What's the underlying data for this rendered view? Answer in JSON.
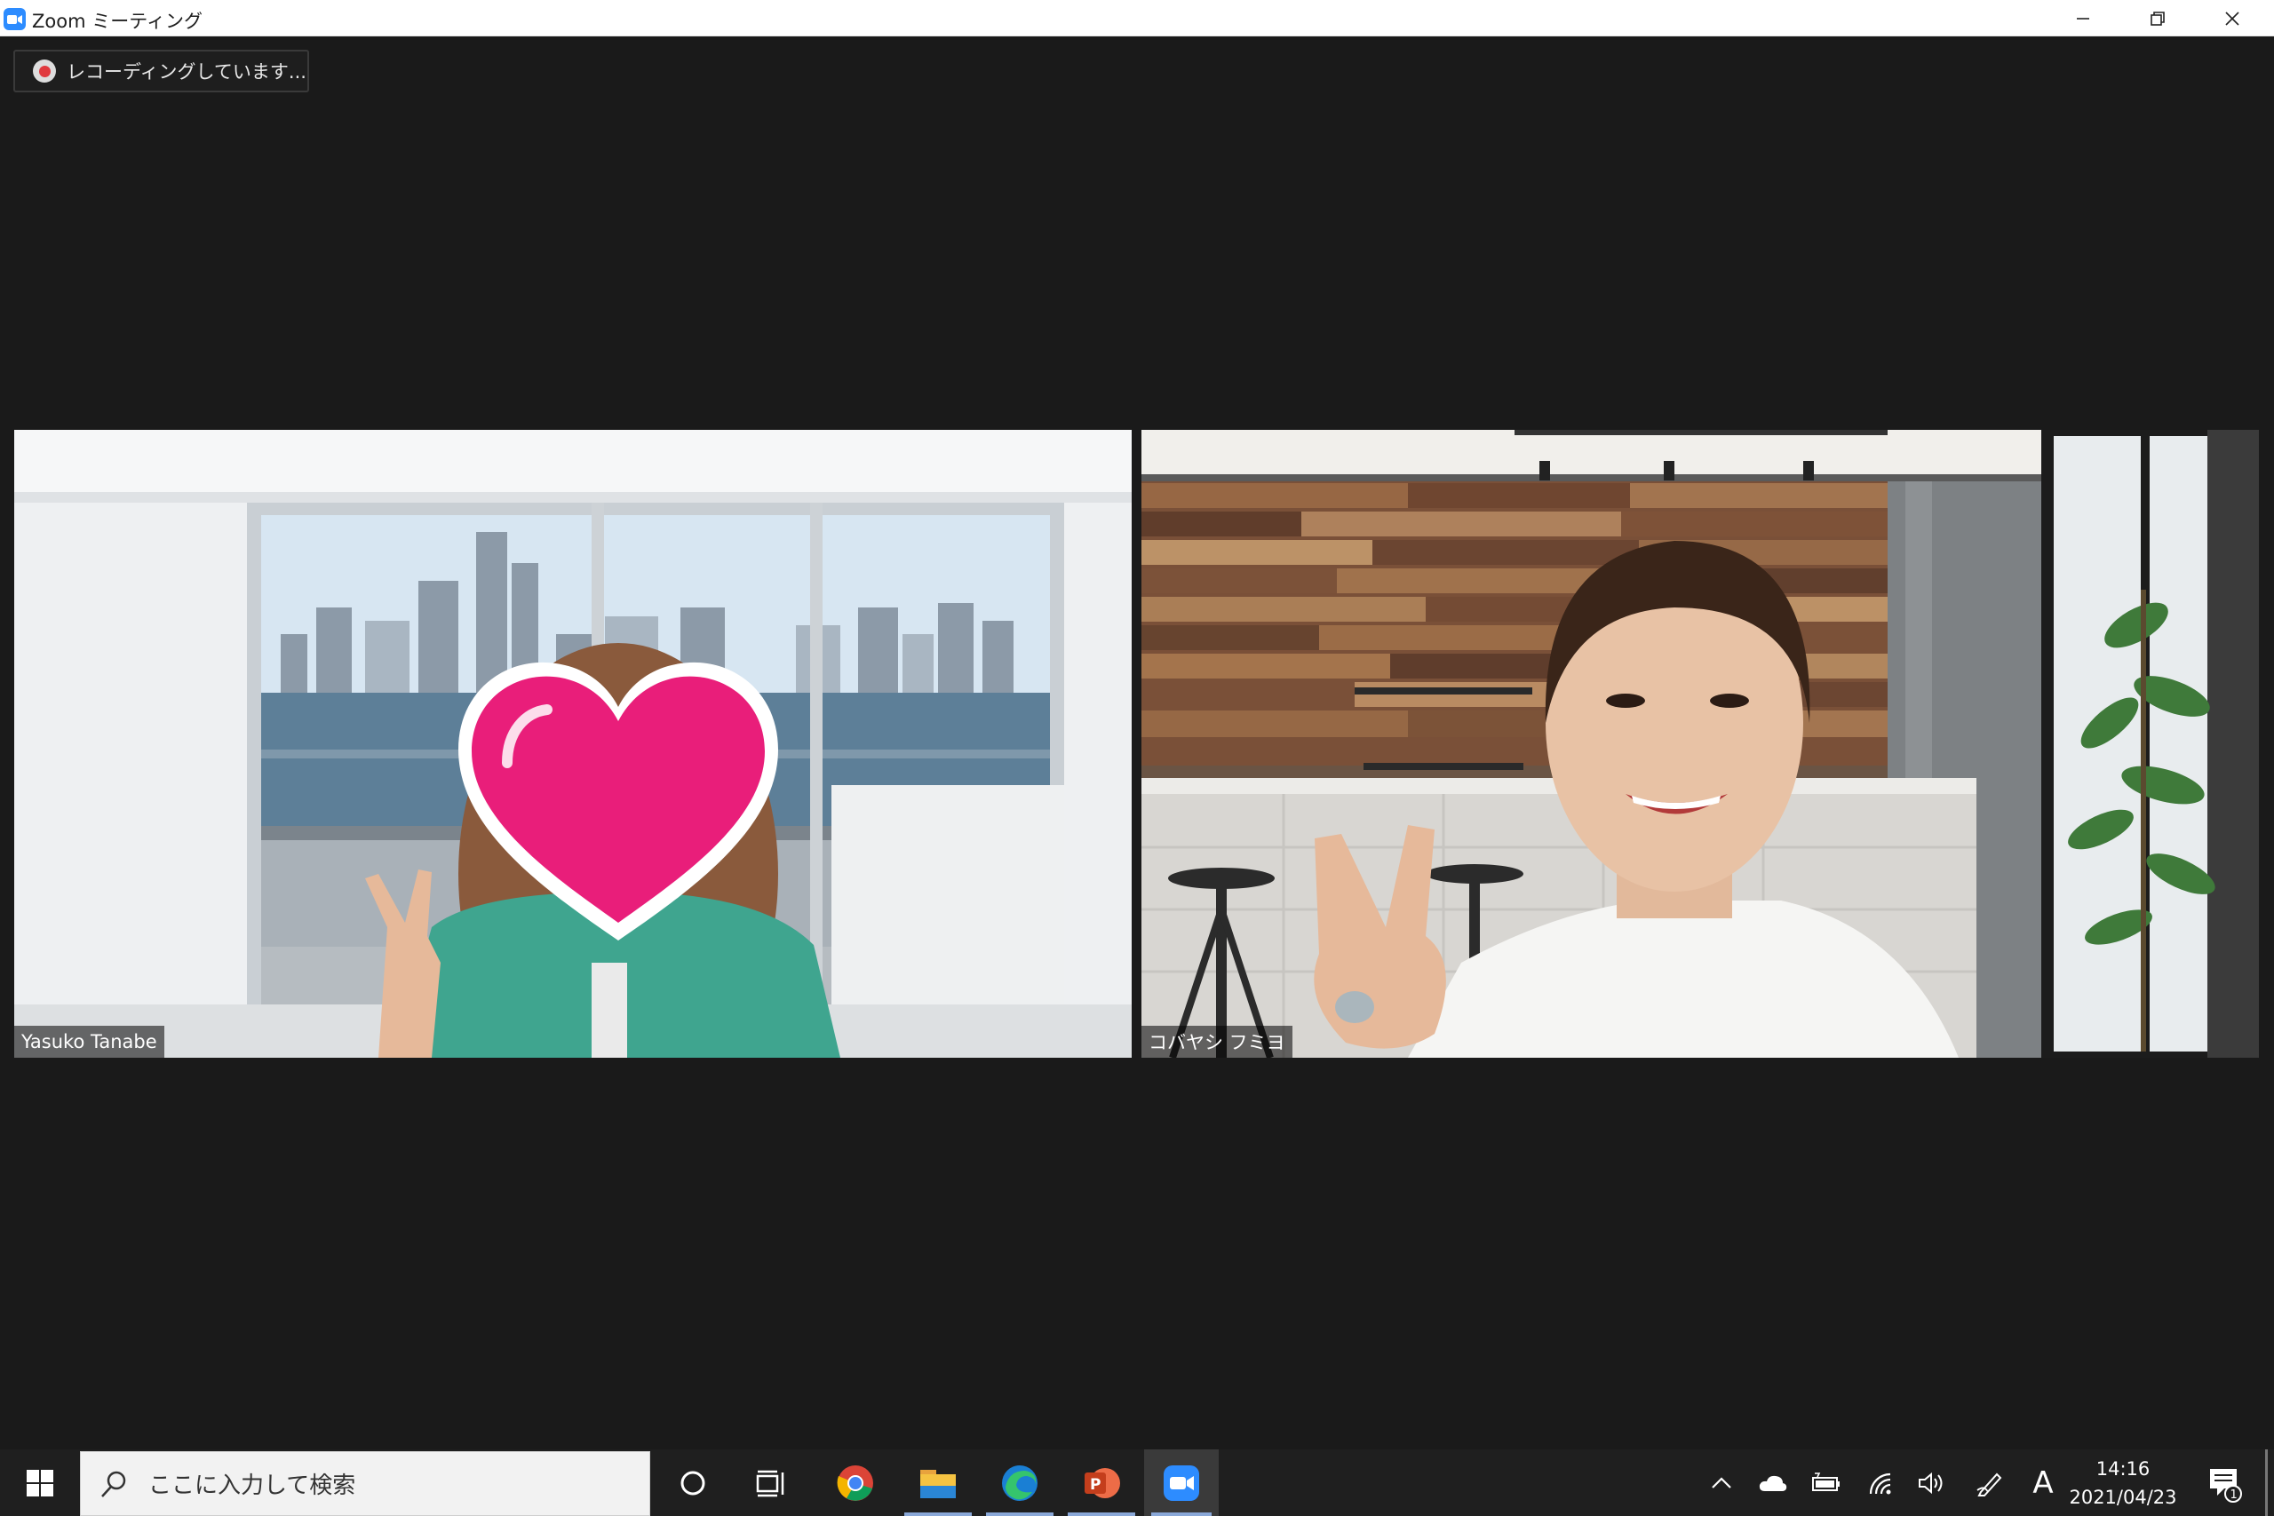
{
  "window": {
    "title": "Zoom ミーティング"
  },
  "recording": {
    "label": "レコーディングしています..."
  },
  "participants": [
    {
      "name": "Yasuko Tanabe"
    },
    {
      "name": "コバヤシ フミヨ"
    }
  ],
  "taskbar": {
    "search_placeholder": "ここに入力して検索",
    "apps": [
      "cortana-icon",
      "task-view-icon",
      "chrome-icon",
      "file-explorer-icon",
      "edge-icon",
      "powerpoint-icon",
      "zoom-icon"
    ],
    "ime_indicator": "A",
    "time": "14:16",
    "date": "2021/04/23",
    "notification_count": "1"
  },
  "colors": {
    "zoom_blue": "#2d8cff",
    "heart_pink": "#e91e7a",
    "recording_red": "#e0393e",
    "meeting_background": "#1a1a1a"
  }
}
